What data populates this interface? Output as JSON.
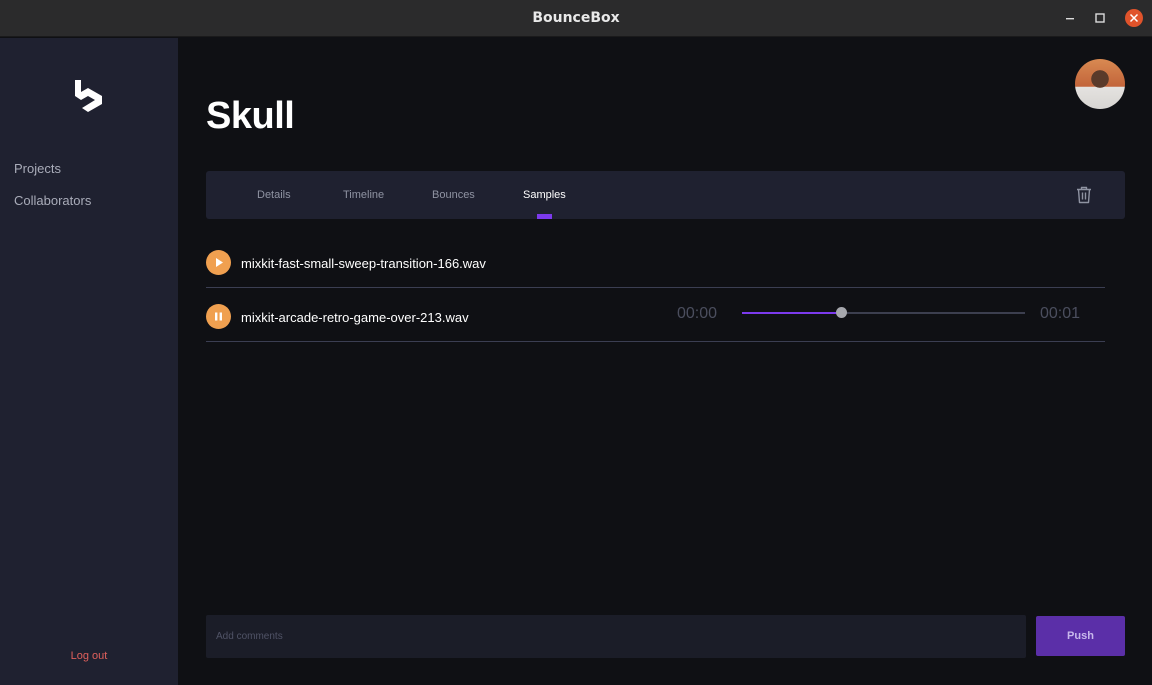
{
  "window": {
    "title": "BounceBox"
  },
  "sidebar": {
    "items": [
      {
        "label": "Projects"
      },
      {
        "label": "Collaborators"
      }
    ],
    "logout_label": "Log out"
  },
  "project": {
    "title": "Skull"
  },
  "tabs": [
    {
      "label": "Details",
      "active": false
    },
    {
      "label": "Timeline",
      "active": false
    },
    {
      "label": "Bounces",
      "active": false
    },
    {
      "label": "Samples",
      "active": true
    }
  ],
  "samples": [
    {
      "name": "mixkit-fast-small-sweep-transition-166.wav",
      "state": "paused",
      "icon": "play-icon"
    },
    {
      "name": "mixkit-arcade-retro-game-over-213.wav",
      "state": "playing",
      "icon": "pause-icon",
      "time_current": "00:00",
      "time_total": "00:01",
      "progress": 0.35
    }
  ],
  "comment": {
    "placeholder": "Add comments",
    "value": ""
  },
  "push_label": "Push",
  "colors": {
    "accent": "#7c3aed",
    "play": "#f0a050",
    "logout": "#e0605c",
    "sidebar": "#1f2130",
    "background": "#0f1014"
  }
}
